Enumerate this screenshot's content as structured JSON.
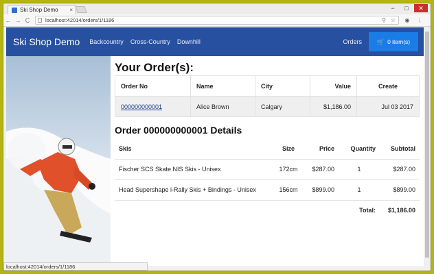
{
  "browser": {
    "tab_title": "Ski Shop Demo",
    "tab_close": "×",
    "url": "localhost:42014/orders/1/1186",
    "status_url": "localhost:42014/orders/1/1186",
    "nav_back": "←",
    "nav_forward": "→",
    "nav_reload": "C",
    "menu_icon": "⋮",
    "win_min": "−",
    "win_max": "□",
    "win_close": "✕"
  },
  "navbar": {
    "brand": "Ski Shop Demo",
    "links": [
      "Backcountry",
      "Cross-Country",
      "Downhill"
    ],
    "orders": "Orders",
    "cart": "0 item(s)"
  },
  "orders": {
    "heading": "Your Order(s):",
    "columns": [
      "Order No",
      "Name",
      "City",
      "Value",
      "Create"
    ],
    "rows": [
      {
        "order_no": "000000000001",
        "name": "Alice Brown",
        "city": "Calgary",
        "value": "$1,186.00",
        "created": "Jul 03 2017"
      }
    ]
  },
  "details": {
    "heading": "Order 000000000001 Details",
    "columns": [
      "Skis",
      "Size",
      "Price",
      "Quantity",
      "Subtotal"
    ],
    "rows": [
      {
        "name": "Fischer SCS Skate NIS Skis - Unisex",
        "size": "172cm",
        "price": "$287.00",
        "qty": "1",
        "subtotal": "$287.00"
      },
      {
        "name": "Head Supershape i-Rally Skis + Bindings - Unisex",
        "size": "156cm",
        "price": "$899.00",
        "qty": "1",
        "subtotal": "$899.00"
      }
    ],
    "total_label": "Total:",
    "total_value": "$1,186.00"
  }
}
